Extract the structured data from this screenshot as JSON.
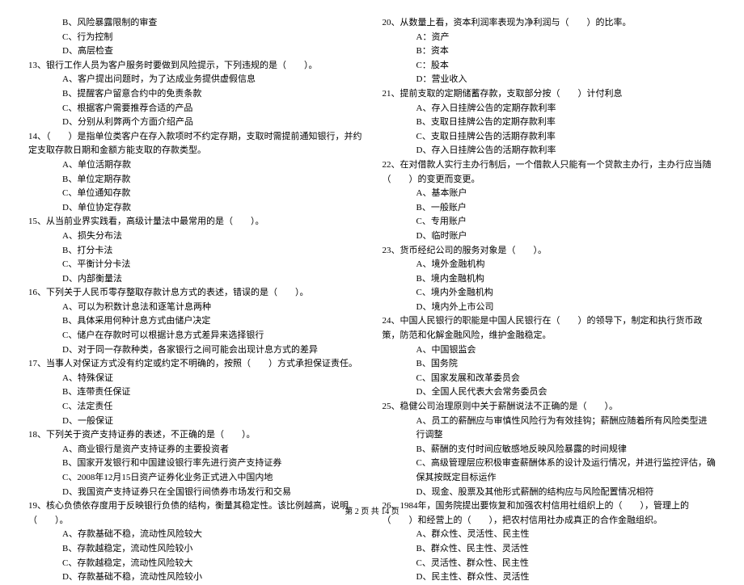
{
  "left_column": {
    "q12_opts": [
      "B、风险暴露限制的审查",
      "C、行为控制",
      "D、高层检查"
    ],
    "q13": "13、银行工作人员为客户服务时要做到风险提示，下列违规的是（　　）。",
    "q13_opts": [
      "A、客户提出问题时，为了达成业务提供虚假信息",
      "B、提醒客户留意合约中的免责条款",
      "C、根据客户需要推荐合适的产品",
      "D、分别从利弊两个方面介绍产品"
    ],
    "q14": "14、（　　）是指单位类客户在存入款项时不约定存期，支取时需提前通知银行，并约定支取存款日期和金额方能支取的存款类型。",
    "q14_opts": [
      "A、单位活期存款",
      "B、单位定期存款",
      "C、单位通知存款",
      "D、单位协定存款"
    ],
    "q15": "15、从当前业界实践看，高级计量法中最常用的是（　　）。",
    "q15_opts": [
      "A、损失分布法",
      "B、打分卡法",
      "C、平衡计分卡法",
      "D、内部衡量法"
    ],
    "q16": "16、下列关于人民币零存整取存款计息方式的表述，错误的是（　　）。",
    "q16_opts": [
      "A、可以为积数计息法和逐笔计息两种",
      "B、具体采用何种计息方式由储户决定",
      "C、储户在存款时可以根据计息方式差异来选择银行",
      "D、对于同一存款种类，各家银行之间可能会出现计息方式的差异"
    ],
    "q17": "17、当事人对保证方式没有约定或约定不明确的，按照（　　）方式承担保证责任。",
    "q17_opts": [
      "A、特殊保证",
      "B、连带责任保证",
      "C、法定责任",
      "D、一般保证"
    ],
    "q18": "18、下列关于资产支持证券的表述，不正确的是（　　）。",
    "q18_opts": [
      "A、商业银行是资产支持证券的主要投资者",
      "B、国家开发银行和中国建设银行率先进行资产支持证券",
      "C、2008年12月15日资产证券化业务正式进入中国内地",
      "D、我国资产支持证券只在全国银行间债券市场发行和交易"
    ],
    "q19": "19、核心负债依存度用于反映银行负债的结构，衡量其稳定性。该比例越高，说明（　　）。",
    "q19_opts": [
      "A、存款基础不稳，流动性风险较大",
      "B、存款越稳定，流动性风险较小",
      "C、存款越稳定，流动性风险较大",
      "D、存款基础不稳，流动性风险较小"
    ]
  },
  "right_column": {
    "q20": "20、从数量上看，资本利润率表现为净利润与（　　）的比率。",
    "q20_opts": [
      "A：资产",
      "B：资本",
      "C：股本",
      "D：营业收入"
    ],
    "q21": "21、提前支取的定期储蓄存款，支取部分按（　　）计付利息",
    "q21_opts": [
      "A、存入日挂牌公告的定期存款利率",
      "B、支取日挂牌公告的定期存款利率",
      "C、支取日挂牌公告的活期存款利率",
      "D、存入日挂牌公告的活期存款利率"
    ],
    "q22": "22、在对借款人实行主办行制后，一个借款人只能有一个贷款主办行，主办行应当随（　　）的变更而变更。",
    "q22_opts": [
      "A、基本账户",
      "B、一般账户",
      "C、专用账户",
      "D、临时账户"
    ],
    "q23": "23、货币经纪公司的服务对象是（　　）。",
    "q23_opts": [
      "A、境外金融机构",
      "B、境内金融机构",
      "C、境内外金融机构",
      "D、境内外上市公司"
    ],
    "q24": "24、中国人民银行的职能是中国人民银行在（　　）的领导下，制定和执行货币政策，防范和化解金融风险，维护金融稳定。",
    "q24_opts": [
      "A、中国银监会",
      "B、国务院",
      "C、国家发展和改革委员会",
      "D、全国人民代表大会常务委员会"
    ],
    "q25": "25、稳健公司治理原则中关于薪酬说法不正确的是（　　）。",
    "q25_opts": [
      "A、员工的薪酬应与审慎性风险行为有效挂钩；薪酬应随着所有风险类型进行调整",
      "B、薪酬的支付时间应敏感地反映风险暴露的时间规律",
      "C、高级管理层应积极审查薪酬体系的设计及运行情况，并进行监控评估，确保其按既定目标运作",
      "D、现金、股票及其他形式薪酬的结构应与风险配置情况相符"
    ],
    "q26": "26、1984年，国务院提出要恢复和加强农村信用社组织上的（　　），管理上的（　　）和经营上的（　　），把农村信用社办成真正的合作金融组织。",
    "q26_opts": [
      "A、群众性、灵活性、民主性",
      "B、群众性、民主性、灵活性",
      "C、灵活性、群众性、民主性",
      "D、民主性、群众性、灵活性"
    ]
  },
  "footer": "第 2 页 共 14 页"
}
